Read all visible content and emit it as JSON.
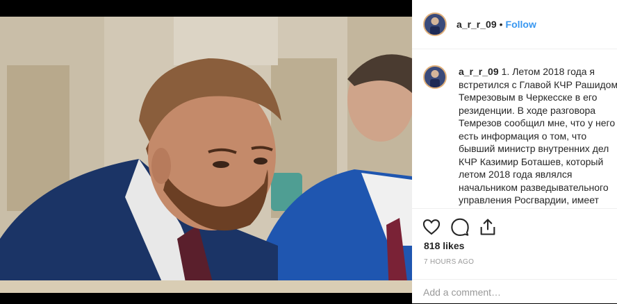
{
  "post": {
    "username": "a_r_r_09",
    "separator": "•",
    "follow_label": "Follow",
    "caption_username": "a_r_r_09",
    "caption_text": "1. Летом 2018 года я встретился с Главой КЧР Рашидом Темрезовым в Черкесске в его резиденции. В ходе разговора Темрезов сообщил мне, что у него есть информация о том, что бывший министр внутренних дел КЧР Казимир Боташев, который летом 2018 года являлся начальником разведывательного управления Росгвардии, имеет намерение",
    "likes": "818 likes",
    "time": "7 HOURS AGO",
    "comment_placeholder": "Add a comment…"
  },
  "colors": {
    "accent": "#3897f0",
    "text": "#262626",
    "muted": "#999999",
    "border": "#efefef"
  },
  "icons": {
    "like": "heart-icon",
    "comment": "speech-bubble-icon",
    "share": "share-icon"
  }
}
